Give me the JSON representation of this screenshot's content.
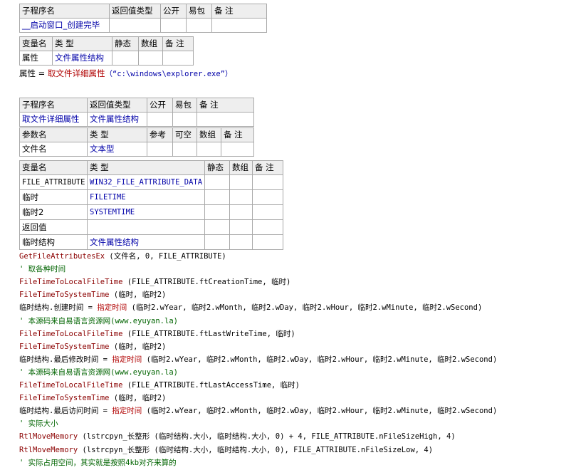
{
  "sub1": {
    "headers": [
      "子程序名",
      "返回值类型",
      "公开",
      "易包",
      "备 注"
    ],
    "row": [
      "__启动窗口_创建完毕",
      "",
      "",
      "",
      ""
    ]
  },
  "var1": {
    "headers": [
      "变量名",
      "类 型",
      "静态",
      "数组",
      "备 注"
    ],
    "row": [
      "属性",
      "文件属性结构",
      "",
      "",
      ""
    ]
  },
  "line1": {
    "lhs": "属性",
    "eq": "=",
    "fn": "取文件详细属性",
    "arg": "（“c:\\windows\\explorer.exe”）"
  },
  "sub2": {
    "headers": [
      "子程序名",
      "返回值类型",
      "公开",
      "易包",
      "备 注"
    ],
    "row": [
      "取文件详细属性",
      "文件属性结构",
      "",
      "",
      ""
    ],
    "param_headers": [
      "参数名",
      "类 型",
      "参考",
      "可空",
      "数组",
      "备 注"
    ],
    "param_row": [
      "文件名",
      "文本型",
      "",
      "",
      "",
      ""
    ]
  },
  "var2": {
    "headers": [
      "变量名",
      "类 型",
      "静态",
      "数组",
      "备 注"
    ],
    "rows": [
      [
        "FILE_ATTRIBUTE",
        "WIN32_FILE_ATTRIBUTE_DATA"
      ],
      [
        "临时",
        "FILETIME"
      ],
      [
        "临时2",
        "SYSTEMTIME"
      ],
      [
        "返回值",
        ""
      ],
      [
        "临时结构",
        "文件属性结构"
      ]
    ]
  },
  "code": [
    {
      "fn": "GetFileAttributesEx",
      "rest": " (文件名, 0, FILE_ATTRIBUTE)"
    },
    {
      "cmt": "' 取各种时间"
    },
    {
      "fn": "FileTimeToLocalFileTime",
      "rest": " (FILE_ATTRIBUTE.ftCreationTime, 临时)"
    },
    {
      "fn": "FileTimeToSystemTime",
      "rest": " (临时, 临时2)"
    },
    {
      "lhs": "临时结构.创建时间 = ",
      "fn2": "指定时间",
      "rest": " (临时2.wYear, 临时2.wMonth, 临时2.wDay, 临时2.wHour, 临时2.wMinute, 临时2.wSecond)"
    },
    {
      "cmt": "' 本源码来自易语言资源网(www.eyuyan.la)"
    },
    {
      "fn": "FileTimeToLocalFileTime",
      "rest": " (FILE_ATTRIBUTE.ftLastWriteTime, 临时)"
    },
    {
      "fn": "FileTimeToSystemTime",
      "rest": " (临时, 临时2)"
    },
    {
      "lhs": "临时结构.最后修改时间 = ",
      "fn2": "指定时间",
      "rest": " (临时2.wYear, 临时2.wMonth, 临时2.wDay, 临时2.wHour, 临时2.wMinute, 临时2.wSecond)"
    },
    {
      "cmt": "' 本源码来自易语言资源网(www.eyuyan.la)"
    },
    {
      "fn": "FileTimeToLocalFileTime",
      "rest": " (FILE_ATTRIBUTE.ftLastAccessTime, 临时)"
    },
    {
      "fn": "FileTimeToSystemTime",
      "rest": " (临时, 临时2)"
    },
    {
      "lhs": "临时结构.最后访问时间 = ",
      "fn2": "指定时间",
      "rest": " (临时2.wYear, 临时2.wMonth, 临时2.wDay, 临时2.wHour, 临时2.wMinute, 临时2.wSecond)"
    },
    {
      "cmt": "' 实际大小"
    },
    {
      "fn": "RtlMoveMemory",
      "rest": " (lstrcpyn_长整形 (临时结构.大小, 临时结构.大小, 0) + 4, FILE_ATTRIBUTE.nFileSizeHigh, 4)"
    },
    {
      "fn": "RtlMoveMemory",
      "rest": " (lstrcpyn_长整形 (临时结构.大小, 临时结构.大小, 0), FILE_ATTRIBUTE.nFileSizeLow, 4)"
    },
    {
      "cmt": "' 实际占用空间，其实就是按照4kb对齐来算的"
    }
  ]
}
